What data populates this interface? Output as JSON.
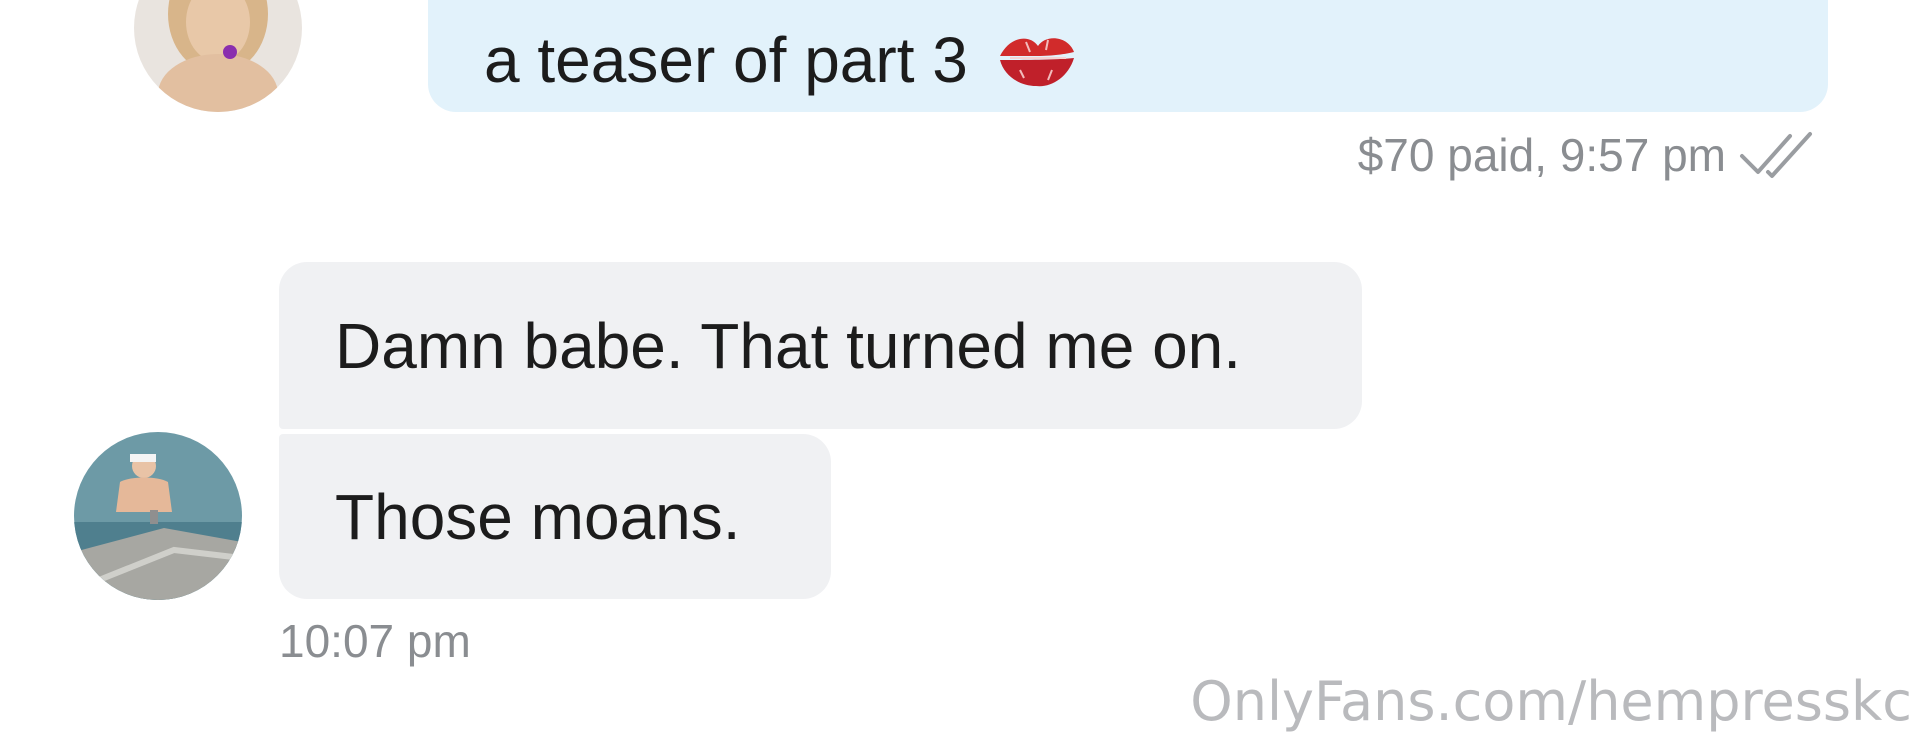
{
  "conversation": {
    "outgoing_message": {
      "text": "a teaser of part 3",
      "emoji": "kiss-mark-icon",
      "status": "$70 paid, 9:57 pm",
      "read_indicator": "double-check-icon"
    },
    "incoming_messages": [
      {
        "text": "Damn babe. That turned me on."
      },
      {
        "text": "Those moans."
      }
    ],
    "incoming_timestamp": "10:07 pm"
  },
  "watermark": "OnlyFans.com/hempresskc",
  "colors": {
    "outgoing_bubble": "#e2f2fb",
    "incoming_bubble": "#f0f1f3",
    "meta_text": "#8a8d91",
    "watermark": "#b9babd"
  }
}
